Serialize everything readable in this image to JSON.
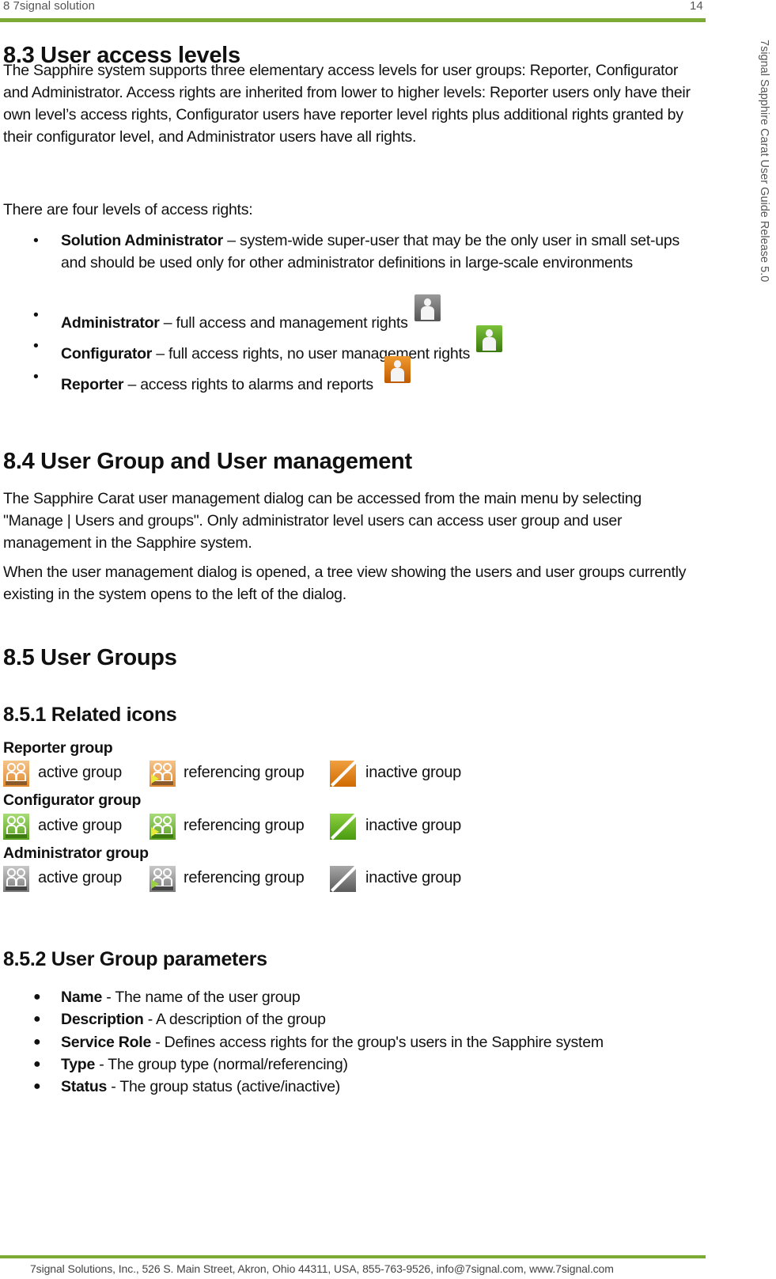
{
  "header": {
    "section": "8 7signal solution",
    "page_number": "14"
  },
  "side_text": "7signal Sapphire Carat User Guide Release 5.0",
  "footer": "7signal Solutions, Inc., 526 S. Main Street, Akron, Ohio 44311, USA, 855-763-9526, info@7signal.com, www.7signal.com",
  "colors": {
    "rule": "#7bab35",
    "reporter": "#e07a10",
    "configurator": "#5a9e1e",
    "administrator": "#6e6e6e"
  },
  "s83": {
    "heading": "8.3 User access levels",
    "para1": "The Sapphire system supports three elementary access levels for user groups: Reporter, Configurator and Administrator. Access rights are inherited from lower to higher levels: Reporter users only have their own level’s access rights, Configurator users have reporter level rights plus additional rights granted by their configurator level, and Administrator users have all rights.",
    "para2": "There are four levels of access rights:",
    "levels": [
      {
        "term": "Solution Administrator",
        "desc": " – system-wide super-user that may be the only user in small set-ups and should be used only for other administrator definitions in large-scale environments",
        "icon": ""
      },
      {
        "term": "Administrator",
        "desc": " – full access and management rights",
        "icon": "administrator-user-icon"
      },
      {
        "term": "Configurator",
        "desc": " – full access rights, no user management rights",
        "icon": "configurator-user-icon"
      },
      {
        "term": "Reporter",
        "desc": " – access rights to alarms and reports",
        "icon": "reporter-user-icon"
      }
    ]
  },
  "s84": {
    "heading": "8.4 User Group and User management",
    "para1": "The Sapphire Carat user management dialog can be accessed from the main menu by selecting \"Manage | Users and groups\". Only administrator level users can access user group and user management in the Sapphire system.",
    "para2": "When the user management dialog is opened, a tree view showing the users and user groups currently existing in the system opens to the left of the dialog."
  },
  "s85": {
    "heading": "8.5 User Groups",
    "s851": {
      "heading": "8.5.1 Related icons",
      "groups": [
        {
          "label": "Reporter group",
          "items": [
            "active group",
            "referencing group",
            "inactive group"
          ]
        },
        {
          "label": "Configurator group",
          "items": [
            "active group",
            "referencing group",
            "inactive group"
          ]
        },
        {
          "label": "Administrator group",
          "items": [
            "active group",
            "referencing group",
            "inactive group"
          ]
        }
      ]
    },
    "s852": {
      "heading": "8.5.2 User Group parameters",
      "params": [
        {
          "term": "Name",
          "desc": " - The name of the user group"
        },
        {
          "term": "Description",
          "desc": " - A description of the group"
        },
        {
          "term": "Service Role",
          "desc": " - Defines access rights for the group's users in the Sapphire system"
        },
        {
          "term": "Type",
          "desc": " - The group type (normal/referencing)"
        },
        {
          "term": "Status",
          "desc": " - The group status (active/inactive)"
        }
      ]
    }
  }
}
